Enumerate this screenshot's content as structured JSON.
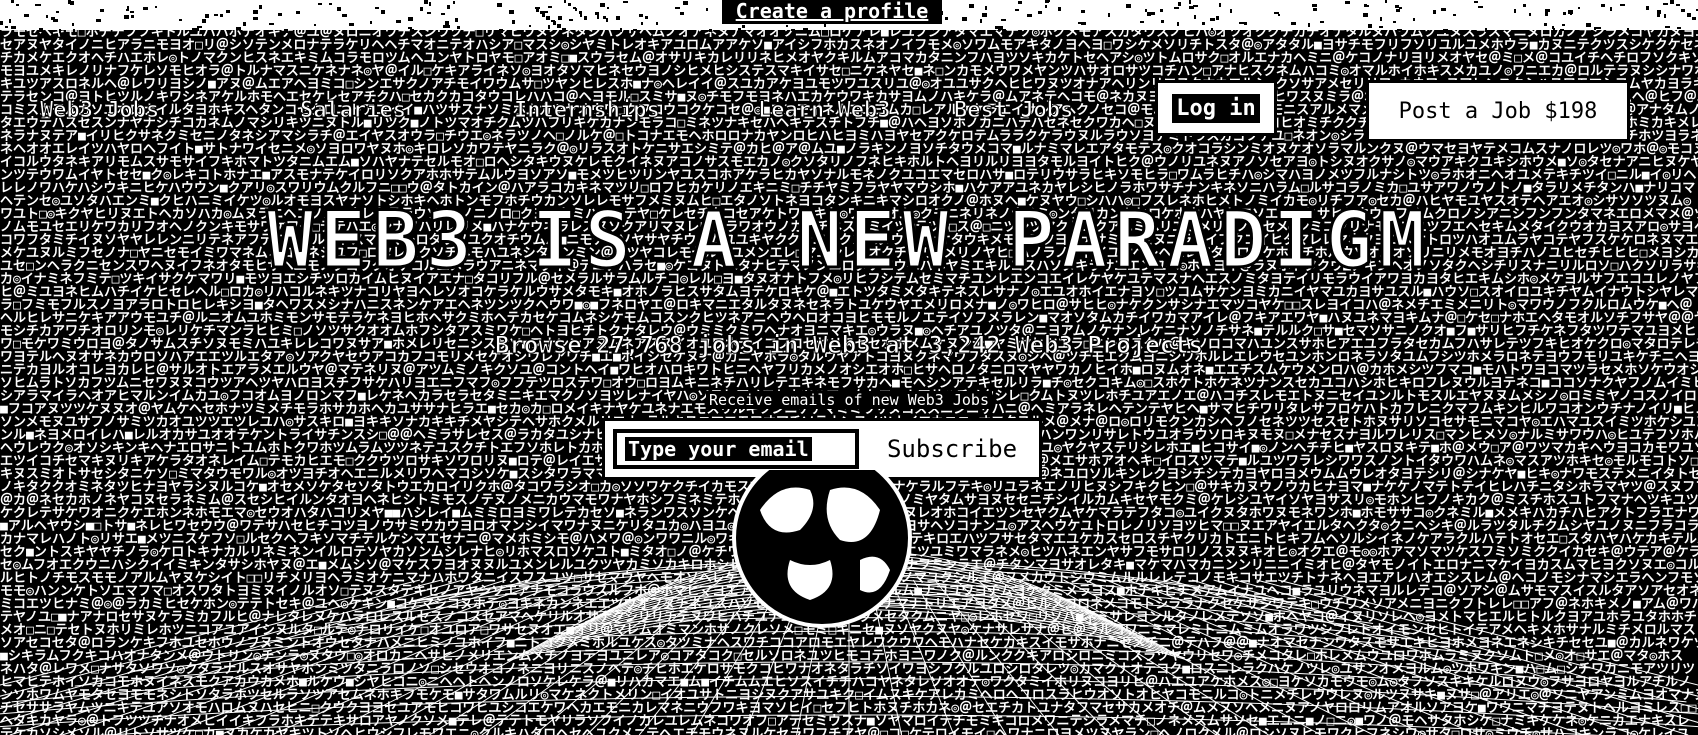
{
  "banner": {
    "create_profile": "Create a profile"
  },
  "nav": {
    "items": [
      {
        "label": "Web3 Jobs"
      },
      {
        "label": "Salaries"
      },
      {
        "label": "Internships"
      },
      {
        "label": "Learn Web3"
      },
      {
        "label": "Best Jobs"
      }
    ],
    "login": "Log in",
    "post_job": "Post a Job $198"
  },
  "hero": {
    "headline": "WEB3 IS A NEW PARADIGM",
    "subline": "Browse 27,768 jobs in Web3 at 3,242 Web3 Projects",
    "emails_label": "Receive emails of new Web3 Jobs",
    "email_placeholder": "Type your email",
    "subscribe": "Subscribe"
  },
  "colors": {
    "background": "#000000",
    "foreground": "#ffffff"
  },
  "icons": {
    "globe": "globe-icon",
    "grid": "wireframe-terrain"
  }
}
